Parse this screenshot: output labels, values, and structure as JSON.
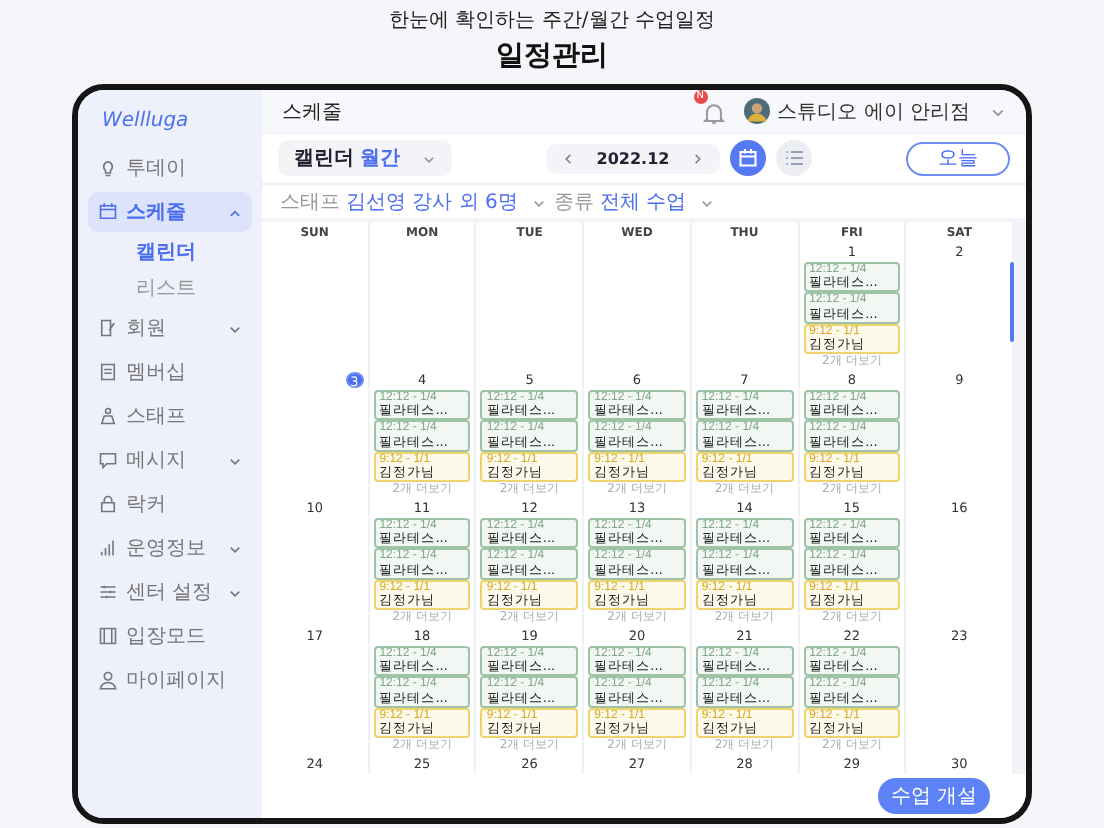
{
  "headline": {
    "subtitle": "한눈에 확인하는 주간/월간 수업일정",
    "title": "일정관리"
  },
  "sidebar": {
    "logo": "Wellluga",
    "items": [
      {
        "label": "투데이",
        "selected": false
      },
      {
        "label": "스케줄",
        "selected": true,
        "expanded": true,
        "children": [
          {
            "label": "캘린더",
            "selected": true
          },
          {
            "label": "리스트",
            "selected": false
          }
        ]
      },
      {
        "label": "회원",
        "selected": false,
        "expanded": false
      },
      {
        "label": "멤버십",
        "selected": false
      },
      {
        "label": "스태프",
        "selected": false
      },
      {
        "label": "메시지",
        "selected": false,
        "expanded": false
      },
      {
        "label": "락커",
        "selected": false
      },
      {
        "label": "운영정보",
        "selected": false,
        "expanded": false
      },
      {
        "label": "센터 설정",
        "selected": false,
        "expanded": false
      },
      {
        "label": "입장모드",
        "selected": false
      },
      {
        "label": "마이페이지",
        "selected": false
      }
    ]
  },
  "topbar": {
    "title": "스케줄",
    "badge": "N",
    "user": "스튜디오 에이 안리점"
  },
  "toolbar": {
    "view_select": {
      "label": "캘린더",
      "value": "월간"
    },
    "month": "2022.12",
    "views": [
      {
        "kind": "calendar",
        "selected": true
      },
      {
        "kind": "list",
        "selected": false
      }
    ],
    "today": "오늘"
  },
  "filters": [
    {
      "label": "스태프",
      "value": "김선영 강사 외 6명"
    },
    {
      "label": "종류",
      "value": "전체 수업"
    }
  ],
  "calendar": {
    "weekdays": [
      "SUN",
      "MON",
      "TUE",
      "WED",
      "THU",
      "FRI",
      "SAT"
    ],
    "weeks": [
      {
        "days": [
          {
            "kind": "empty"
          },
          {
            "kind": "empty"
          },
          {
            "kind": "empty"
          },
          {
            "kind": "empty"
          },
          {
            "kind": "empty"
          },
          {
            "kind": "day",
            "date": "1",
            "today": false,
            "events": [
              {
                "time": "12:12 - 1/4",
                "title": "필라테스...",
                "color": "#9fc3a6"
              },
              {
                "time": "12:12 - 1/4",
                "title": "필라테스...",
                "color": "#9fc3a6"
              },
              {
                "time": "9:12 - 1/1",
                "title": "김정가님",
                "color": "#f2d36b"
              }
            ],
            "more": "2개 더보기"
          },
          {
            "kind": "day",
            "date": "2",
            "today": false
          }
        ]
      },
      {
        "days": [
          {
            "kind": "day",
            "date": "3",
            "today": true
          },
          {
            "kind": "day",
            "date": "4",
            "today": false,
            "events": [
              {
                "time": "12:12 - 1/4",
                "title": "필라테스...",
                "color": "#9fc3a6"
              },
              {
                "time": "12:12 - 1/4",
                "title": "필라테스...",
                "color": "#9fc3a6"
              },
              {
                "time": "9:12 - 1/1",
                "title": "김정가님",
                "color": "#f2d36b"
              }
            ],
            "more": "2개 더보기"
          },
          {
            "kind": "day",
            "date": "5",
            "today": false,
            "events": [
              {
                "time": "12:12 - 1/4",
                "title": "필라테스...",
                "color": "#9fc3a6"
              },
              {
                "time": "12:12 - 1/4",
                "title": "필라테스...",
                "color": "#9fc3a6"
              },
              {
                "time": "9:12 - 1/1",
                "title": "김정가님",
                "color": "#f2d36b"
              }
            ],
            "more": "2개 더보기"
          },
          {
            "kind": "day",
            "date": "6",
            "today": false,
            "events": [
              {
                "time": "12:12 - 1/4",
                "title": "필라테스...",
                "color": "#9fc3a6"
              },
              {
                "time": "12:12 - 1/4",
                "title": "필라테스...",
                "color": "#9fc3a6"
              },
              {
                "time": "9:12 - 1/1",
                "title": "김정가님",
                "color": "#f2d36b"
              }
            ],
            "more": "2개 더보기"
          },
          {
            "kind": "day",
            "date": "7",
            "today": false,
            "events": [
              {
                "time": "12:12 - 1/4",
                "title": "필라테스...",
                "color": "#9fc3a6"
              },
              {
                "time": "12:12 - 1/4",
                "title": "필라테스...",
                "color": "#9fc3a6"
              },
              {
                "time": "9:12 - 1/1",
                "title": "김정가님",
                "color": "#f2d36b"
              }
            ],
            "more": "2개 더보기"
          },
          {
            "kind": "day",
            "date": "8",
            "today": false,
            "events": [
              {
                "time": "12:12 - 1/4",
                "title": "필라테스...",
                "color": "#9fc3a6"
              },
              {
                "time": "12:12 - 1/4",
                "title": "필라테스...",
                "color": "#9fc3a6"
              },
              {
                "time": "9:12 - 1/1",
                "title": "김정가님",
                "color": "#f2d36b"
              }
            ],
            "more": "2개 더보기"
          },
          {
            "kind": "day",
            "date": "9",
            "today": false
          }
        ]
      },
      {
        "days": [
          {
            "kind": "day",
            "date": "10",
            "today": false
          },
          {
            "kind": "day",
            "date": "11",
            "today": false,
            "events": [
              {
                "time": "12:12 - 1/4",
                "title": "필라테스...",
                "color": "#9fc3a6"
              },
              {
                "time": "12:12 - 1/4",
                "title": "필라테스...",
                "color": "#9fc3a6"
              },
              {
                "time": "9:12 - 1/1",
                "title": "김정가님",
                "color": "#f2d36b"
              }
            ],
            "more": "2개 더보기"
          },
          {
            "kind": "day",
            "date": "12",
            "today": false,
            "events": [
              {
                "time": "12:12 - 1/4",
                "title": "필라테스...",
                "color": "#9fc3a6"
              },
              {
                "time": "12:12 - 1/4",
                "title": "필라테스...",
                "color": "#9fc3a6"
              },
              {
                "time": "9:12 - 1/1",
                "title": "김정가님",
                "color": "#f2d36b"
              }
            ],
            "more": "2개 더보기"
          },
          {
            "kind": "day",
            "date": "13",
            "today": false,
            "events": [
              {
                "time": "12:12 - 1/4",
                "title": "필라테스...",
                "color": "#9fc3a6"
              },
              {
                "time": "12:12 - 1/4",
                "title": "필라테스...",
                "color": "#9fc3a6"
              },
              {
                "time": "9:12 - 1/1",
                "title": "김정가님",
                "color": "#f2d36b"
              }
            ],
            "more": "2개 더보기"
          },
          {
            "kind": "day",
            "date": "14",
            "today": false,
            "events": [
              {
                "time": "12:12 - 1/4",
                "title": "필라테스...",
                "color": "#9fc3a6"
              },
              {
                "time": "12:12 - 1/4",
                "title": "필라테스...",
                "color": "#9fc3a6"
              },
              {
                "time": "9:12 - 1/1",
                "title": "김정가님",
                "color": "#f2d36b"
              }
            ],
            "more": "2개 더보기"
          },
          {
            "kind": "day",
            "date": "15",
            "today": false,
            "events": [
              {
                "time": "12:12 - 1/4",
                "title": "필라테스...",
                "color": "#9fc3a6"
              },
              {
                "time": "12:12 - 1/4",
                "title": "필라테스...",
                "color": "#9fc3a6"
              },
              {
                "time": "9:12 - 1/1",
                "title": "김정가님",
                "color": "#f2d36b"
              }
            ],
            "more": "2개 더보기"
          },
          {
            "kind": "day",
            "date": "16",
            "today": false
          }
        ]
      },
      {
        "days": [
          {
            "kind": "day",
            "date": "17",
            "today": false
          },
          {
            "kind": "day",
            "date": "18",
            "today": false,
            "events": [
              {
                "time": "12:12 - 1/4",
                "title": "필라테스...",
                "color": "#9fc3a6"
              },
              {
                "time": "12:12 - 1/4",
                "title": "필라테스...",
                "color": "#9fc3a6"
              },
              {
                "time": "9:12 - 1/1",
                "title": "김정가님",
                "color": "#f2d36b"
              }
            ],
            "more": "2개 더보기"
          },
          {
            "kind": "day",
            "date": "19",
            "today": false,
            "events": [
              {
                "time": "12:12 - 1/4",
                "title": "필라테스...",
                "color": "#9fc3a6"
              },
              {
                "time": "12:12 - 1/4",
                "title": "필라테스...",
                "color": "#9fc3a6"
              },
              {
                "time": "9:12 - 1/1",
                "title": "김정가님",
                "color": "#f2d36b"
              }
            ],
            "more": "2개 더보기"
          },
          {
            "kind": "day",
            "date": "20",
            "today": false,
            "events": [
              {
                "time": "12:12 - 1/4",
                "title": "필라테스...",
                "color": "#9fc3a6"
              },
              {
                "time": "12:12 - 1/4",
                "title": "필라테스...",
                "color": "#9fc3a6"
              },
              {
                "time": "9:12 - 1/1",
                "title": "김정가님",
                "color": "#f2d36b"
              }
            ],
            "more": "2개 더보기"
          },
          {
            "kind": "day",
            "date": "21",
            "today": false,
            "events": [
              {
                "time": "12:12 - 1/4",
                "title": "필라테스...",
                "color": "#9fc3a6"
              },
              {
                "time": "12:12 - 1/4",
                "title": "필라테스...",
                "color": "#9fc3a6"
              },
              {
                "time": "9:12 - 1/1",
                "title": "김정가님",
                "color": "#f2d36b"
              }
            ],
            "more": "2개 더보기"
          },
          {
            "kind": "day",
            "date": "22",
            "today": false,
            "events": [
              {
                "time": "12:12 - 1/4",
                "title": "필라테스...",
                "color": "#9fc3a6"
              },
              {
                "time": "12:12 - 1/4",
                "title": "필라테스...",
                "color": "#9fc3a6"
              },
              {
                "time": "9:12 - 1/1",
                "title": "김정가님",
                "color": "#f2d36b"
              }
            ],
            "more": "2개 더보기"
          },
          {
            "kind": "day",
            "date": "23",
            "today": false
          }
        ]
      },
      {
        "days": [
          {
            "kind": "day",
            "date": "24",
            "today": false
          },
          {
            "kind": "day",
            "date": "25",
            "today": false
          },
          {
            "kind": "day",
            "date": "26",
            "today": false
          },
          {
            "kind": "day",
            "date": "27",
            "today": false
          },
          {
            "kind": "day",
            "date": "28",
            "today": false
          },
          {
            "kind": "day",
            "date": "29",
            "today": false
          },
          {
            "kind": "day",
            "date": "30",
            "today": false
          }
        ]
      }
    ]
  },
  "create_button": "수업 개설"
}
